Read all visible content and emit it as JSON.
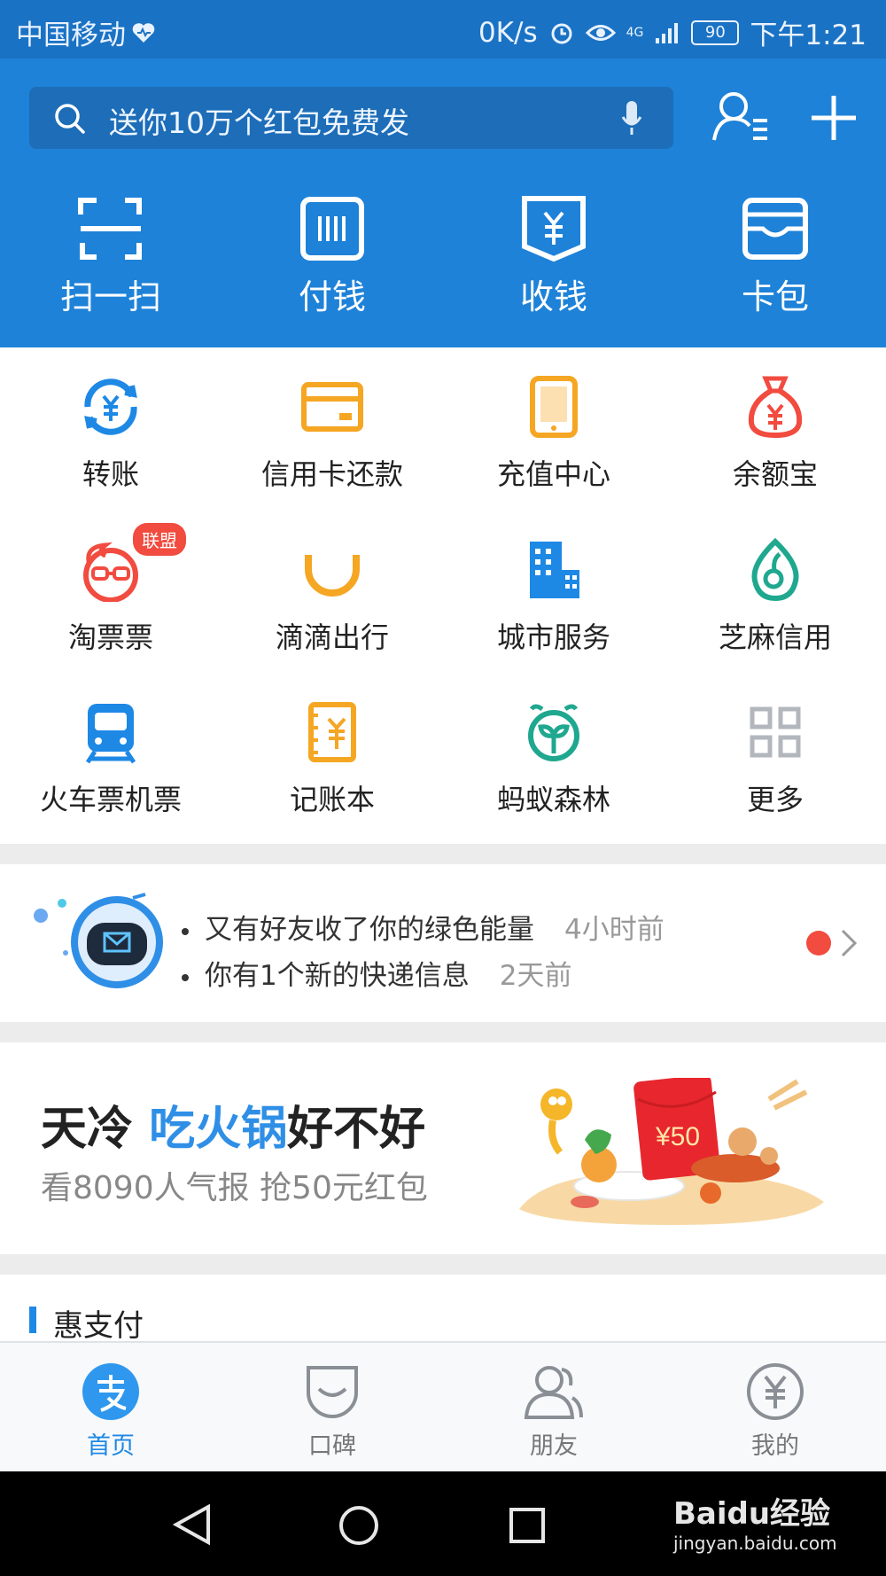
{
  "status_bar": {
    "carrier": "中国移动",
    "speed": "0K/s",
    "network": "4G",
    "battery": "90",
    "time": "下午1:21"
  },
  "search": {
    "placeholder": "送你10万个红包免费发"
  },
  "quick_actions": [
    {
      "label": "扫一扫",
      "icon": "scan-icon"
    },
    {
      "label": "付钱",
      "icon": "pay-code-icon"
    },
    {
      "label": "收钱",
      "icon": "receive-money-icon"
    },
    {
      "label": "卡包",
      "icon": "card-wallet-icon"
    }
  ],
  "services": [
    {
      "label": "转账",
      "icon": "transfer-icon"
    },
    {
      "label": "信用卡还款",
      "icon": "credit-card-icon"
    },
    {
      "label": "充值中心",
      "icon": "phone-recharge-icon"
    },
    {
      "label": "余额宝",
      "icon": "money-bag-icon"
    },
    {
      "label": "淘票票",
      "icon": "taopiaopiao-icon",
      "badge": "联盟"
    },
    {
      "label": "滴滴出行",
      "icon": "didi-icon"
    },
    {
      "label": "城市服务",
      "icon": "city-building-icon"
    },
    {
      "label": "芝麻信用",
      "icon": "sesame-credit-icon"
    },
    {
      "label": "火车票机票",
      "icon": "train-icon"
    },
    {
      "label": "记账本",
      "icon": "ledger-icon"
    },
    {
      "label": "蚂蚁森林",
      "icon": "ant-forest-icon"
    },
    {
      "label": "更多",
      "icon": "more-grid-icon"
    }
  ],
  "news": [
    {
      "text": "又有好友收了你的绿色能量",
      "time": "4小时前"
    },
    {
      "text": "你有1个新的快递信息",
      "time": "2天前"
    }
  ],
  "banner": {
    "title_prefix": "天冷 ",
    "title_highlight": "吃火锅",
    "title_suffix": "好不好",
    "subtitle": "看8090人气报 抢50元红包",
    "red_packet_amount": "¥50"
  },
  "section": {
    "title": "惠支付"
  },
  "tabs": [
    {
      "label": "首页",
      "active": true
    },
    {
      "label": "口碑",
      "active": false
    },
    {
      "label": "朋友",
      "active": false
    },
    {
      "label": "我的",
      "active": false
    }
  ],
  "watermark": {
    "brand": "Baidu经验",
    "url": "jingyan.baidu.com"
  },
  "colors": {
    "header_blue": "#1e82d8",
    "status_blue": "#1a72c4",
    "accent_blue": "#1e88e5",
    "orange": "#f5a623",
    "red": "#f24b3f",
    "teal": "#1fa88f"
  }
}
